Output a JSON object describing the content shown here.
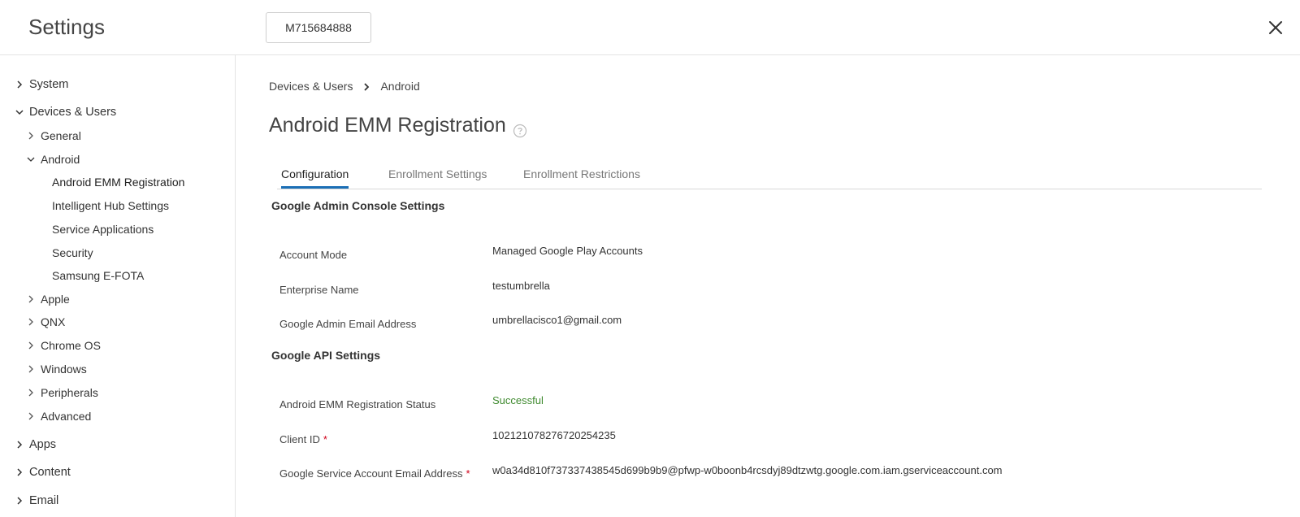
{
  "header": {
    "title": "Settings",
    "org_button": "M715684888",
    "close_icon": "close-icon"
  },
  "sidebar": {
    "system": "System",
    "devices_users": "Devices & Users",
    "general": "General",
    "android": "Android",
    "android_emm": "Android EMM Registration",
    "hub_settings": "Intelligent Hub Settings",
    "service_apps": "Service Applications",
    "security": "Security",
    "samsung": "Samsung E-FOTA",
    "apple": "Apple",
    "qnx": "QNX",
    "chrome_os": "Chrome OS",
    "windows": "Windows",
    "peripherals": "Peripherals",
    "advanced": "Advanced",
    "apps": "Apps",
    "content": "Content",
    "email": "Email"
  },
  "breadcrumb": {
    "parent": "Devices & Users",
    "current": "Android"
  },
  "page": {
    "title": "Android EMM Registration"
  },
  "tabs": {
    "configuration": "Configuration",
    "enrollment_settings": "Enrollment Settings",
    "enrollment_restrictions": "Enrollment Restrictions"
  },
  "google_admin": {
    "title": "Google Admin Console Settings",
    "account_mode_label": "Account Mode",
    "account_mode_value": "Managed Google Play Accounts",
    "enterprise_name_label": "Enterprise Name",
    "enterprise_name_value": "testumbrella",
    "admin_email_label": "Google Admin Email Address",
    "admin_email_value": "umbrellacisco1@gmail.com"
  },
  "google_api": {
    "title": "Google API Settings",
    "status_label": "Android EMM Registration Status",
    "status_value": "Successful",
    "client_id_label": "Client ID",
    "client_id_value": "102121078276720254235",
    "service_email_label": "Google Service Account Email Address",
    "service_email_value": "w0a34d810f737337438545d699b9b9@pfwp-w0boonb4rcsdyj89dtzwtg.google.com.iam.gserviceaccount.com",
    "required_marker": "*"
  },
  "colors": {
    "accent": "#1b6fb6",
    "success": "#3f8a2f",
    "required": "#d0021b"
  }
}
